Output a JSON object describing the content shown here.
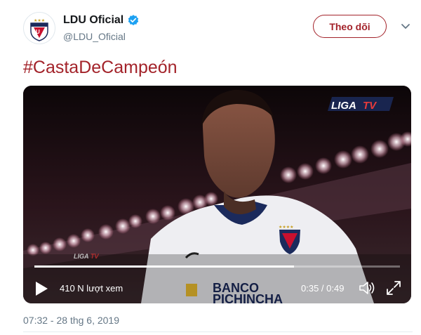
{
  "tweet": {
    "author": {
      "display_name": "LDU Oficial",
      "handle": "@LDU_Oficial",
      "verified": true,
      "avatar_icon": "ldu-crest-icon"
    },
    "follow_label": "Theo dõi",
    "text": "#CastaDeCampeón",
    "timestamp": "07:32 - 28 thg 6, 2019"
  },
  "video": {
    "watermark": "LIGA TV",
    "views": "410 N lượt xem",
    "time": "0:35 / 0:49",
    "progress": 0.71,
    "jersey_sponsor": "BANCO PICHINCHA",
    "controls": [
      "play-icon",
      "volume-icon",
      "fullscreen-icon"
    ]
  },
  "colors": {
    "brand_red": "#a3232a",
    "verified_blue": "#1da1f2",
    "muted_text": "#657786"
  }
}
